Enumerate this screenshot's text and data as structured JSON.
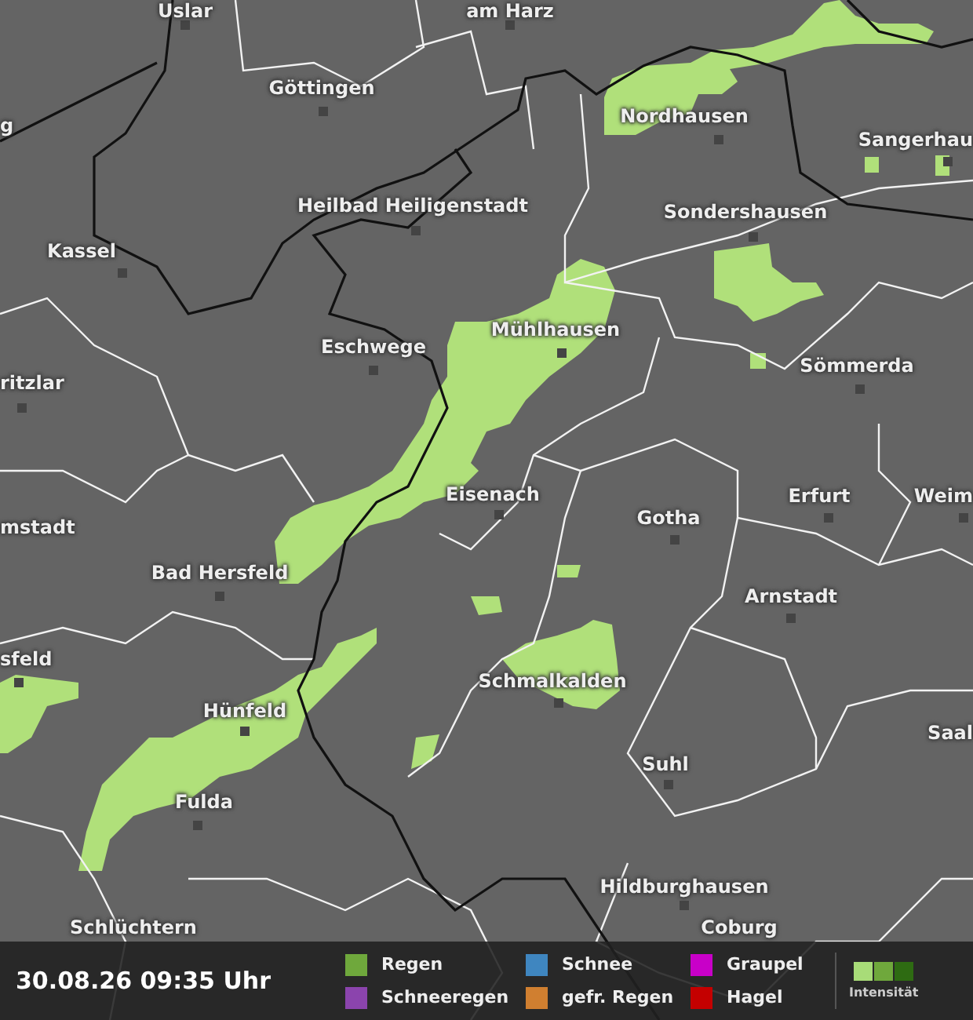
{
  "map": {
    "places": [
      {
        "name": "Uslar"
      },
      {
        "name": "am Harz"
      },
      {
        "name": "Göttingen"
      },
      {
        "name": "g"
      },
      {
        "name": "Nordhausen"
      },
      {
        "name": "Sangerhau"
      },
      {
        "name": "Heilbad Heiligenstadt"
      },
      {
        "name": "Sondershausen"
      },
      {
        "name": "Kassel"
      },
      {
        "name": "Mühlhausen"
      },
      {
        "name": "Eschwege"
      },
      {
        "name": "Sömmerda"
      },
      {
        "name": "ritzlar"
      },
      {
        "name": "Eisenach"
      },
      {
        "name": "Erfurt"
      },
      {
        "name": "Weim"
      },
      {
        "name": "Gotha"
      },
      {
        "name": "mstadt"
      },
      {
        "name": "Bad Hersfeld"
      },
      {
        "name": "Arnstadt"
      },
      {
        "name": "sfeld"
      },
      {
        "name": "Schmalkalden"
      },
      {
        "name": "Hünfeld"
      },
      {
        "name": "Saal"
      },
      {
        "name": "Suhl"
      },
      {
        "name": "Fulda"
      },
      {
        "name": "Hildburghausen"
      },
      {
        "name": "Schlüchtern"
      },
      {
        "name": "Coburg"
      }
    ]
  },
  "legend": {
    "timestamp": "30.08.26 09:35 Uhr",
    "items": [
      {
        "label": "Regen",
        "color": "#6fa83c"
      },
      {
        "label": "Schneeregen",
        "color": "#8b44ad"
      },
      {
        "label": "Schnee",
        "color": "#3f86c0"
      },
      {
        "label": "gefr. Regen",
        "color": "#d07f30"
      },
      {
        "label": "Graupel",
        "color": "#c800c8"
      },
      {
        "label": "Hagel",
        "color": "#c40000"
      }
    ],
    "intensity": {
      "label": "Intensität",
      "swatches": [
        {
          "color": "#a8dc78"
        },
        {
          "color": "#6fa83c"
        },
        {
          "color": "#2e6b12"
        }
      ]
    }
  }
}
